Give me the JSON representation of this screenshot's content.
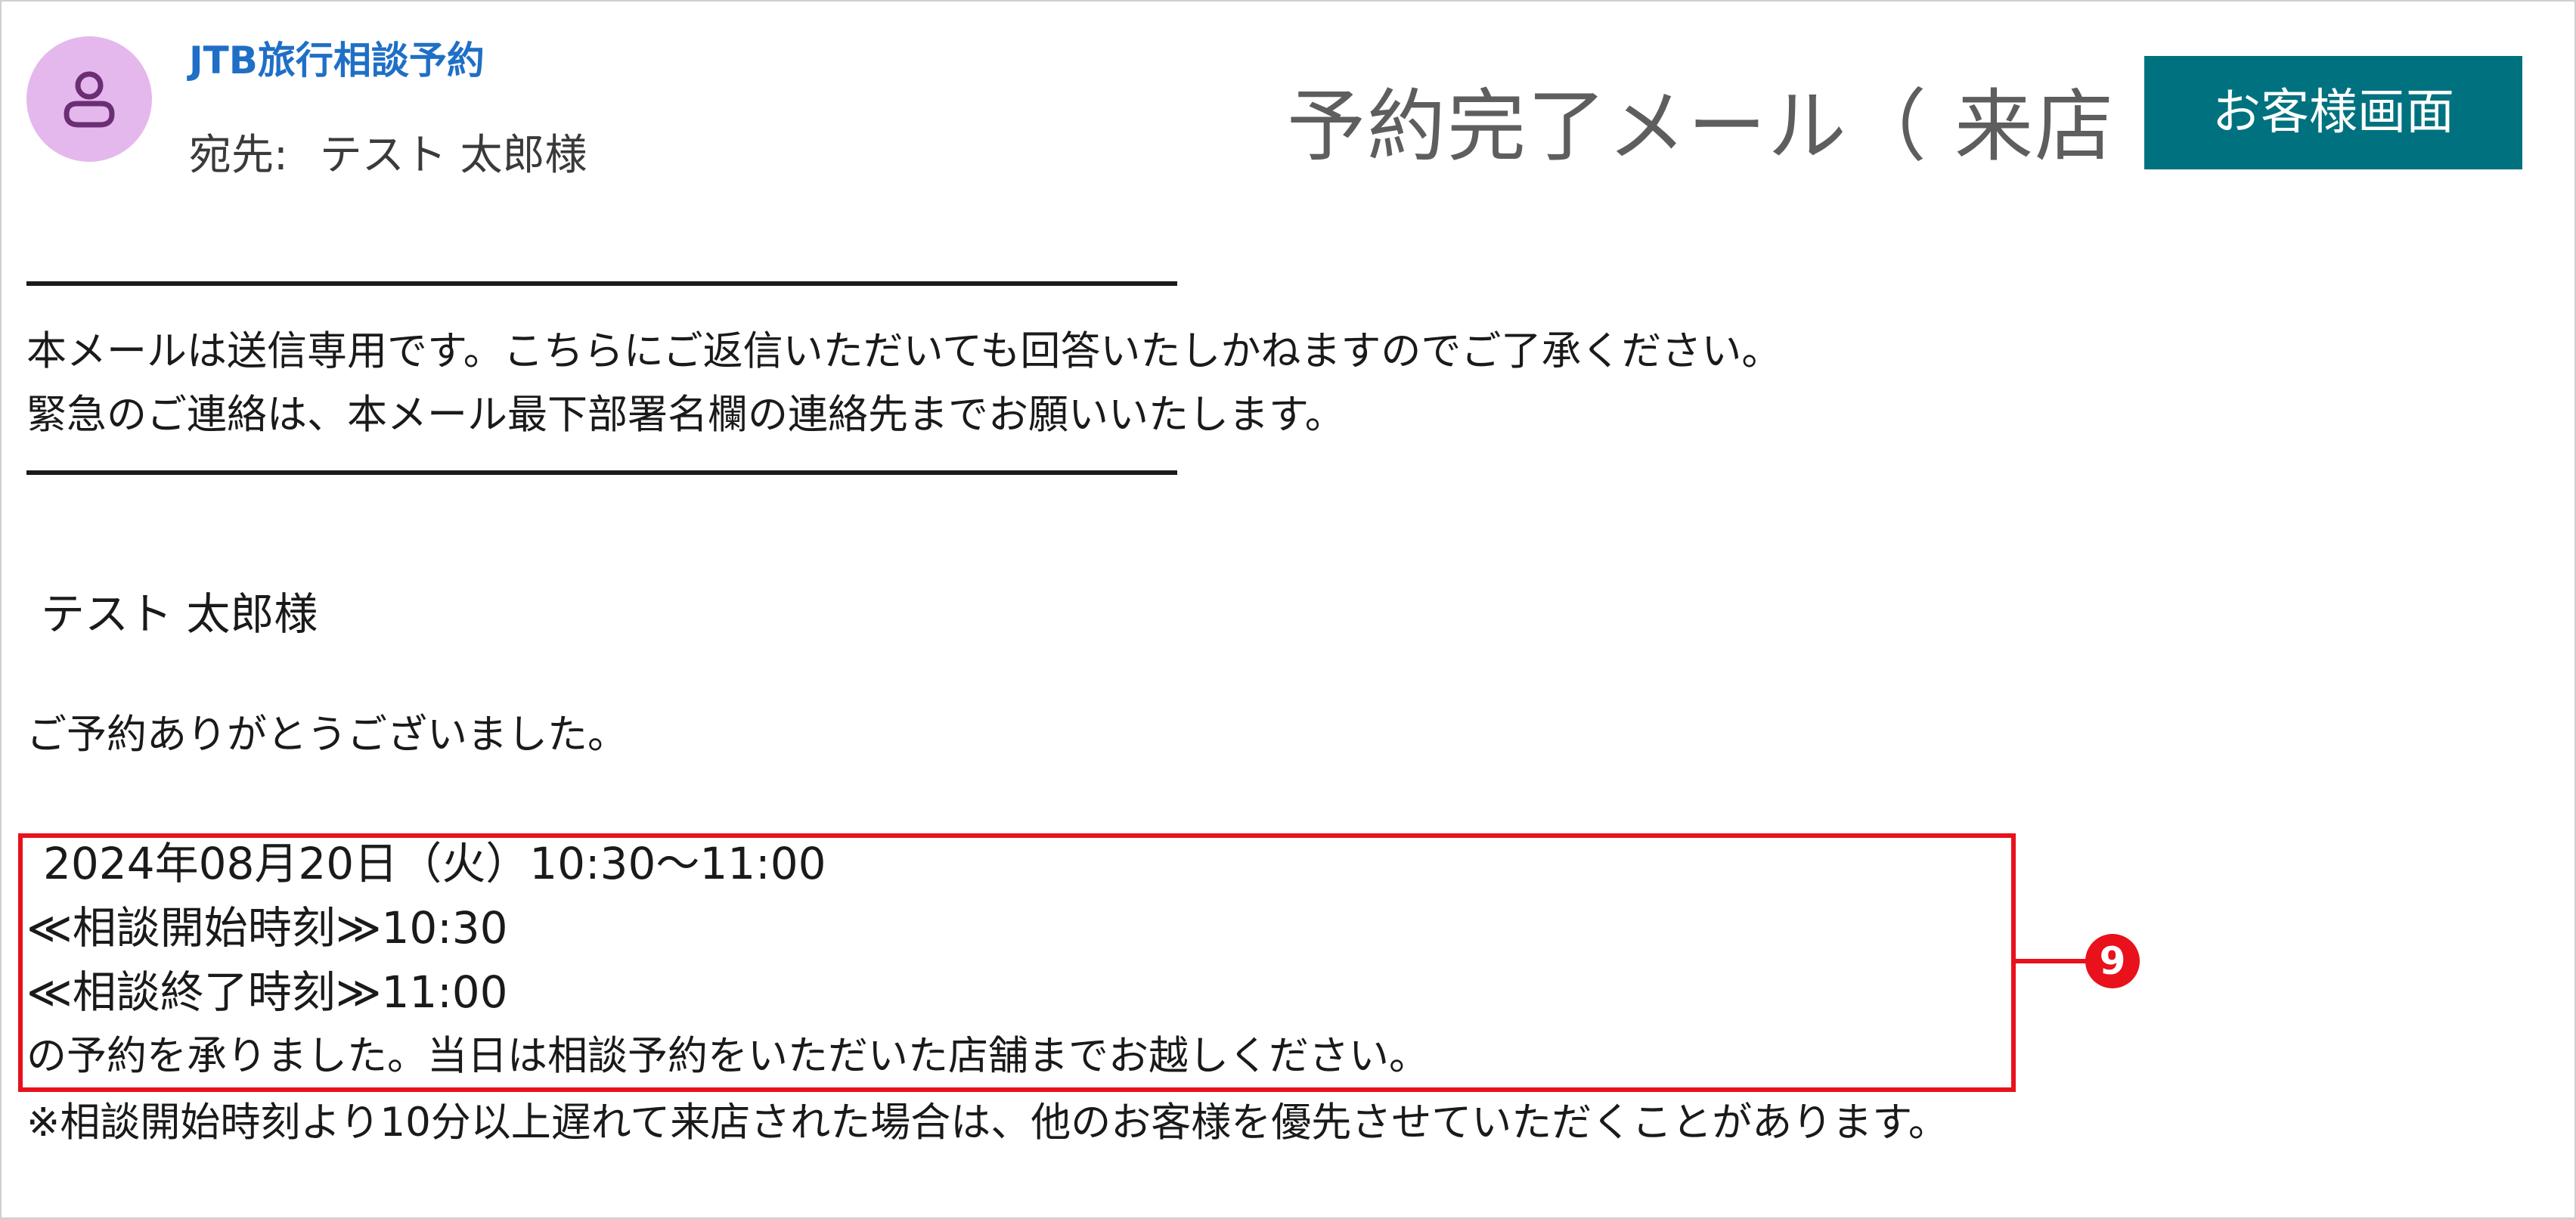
{
  "header": {
    "sender_name": "JTB旅行相談予約",
    "to_label": "宛先:",
    "to_value": "テスト 太郎様",
    "title": "予約完了メール（ 来店 ）",
    "screen_button_label": "お客様画面",
    "avatar_icon": "user-icon"
  },
  "body": {
    "notice_lines": [
      "本メールは送信専用です。こちらにご返信いただいても回答いたしかねますのでご了承ください。",
      "緊急のご連絡は、本メール最下部署名欄の連絡先までお願いいたします。"
    ],
    "recipient": "テスト 太郎様",
    "thanks": "ご予約ありがとうございました。",
    "reservation_lines": [
      "2024年08月20日（火）10:30～11:00",
      "≪相談開始時刻≫10:30",
      "≪相談終了時刻≫11:00",
      "の予約を承りました。当日は相談予約をいただいた店舗までお越しください。"
    ],
    "late_note": "※相談開始時刻より10分以上遅れて来店された場合は、他のお客様を優先させていただくことがあります。"
  },
  "annotation": {
    "callout_number": "9",
    "color": "#e8111c"
  },
  "colors": {
    "sender_blue": "#1f6fc6",
    "button_teal": "#00727f",
    "avatar_purple": "#e4b8ec"
  }
}
